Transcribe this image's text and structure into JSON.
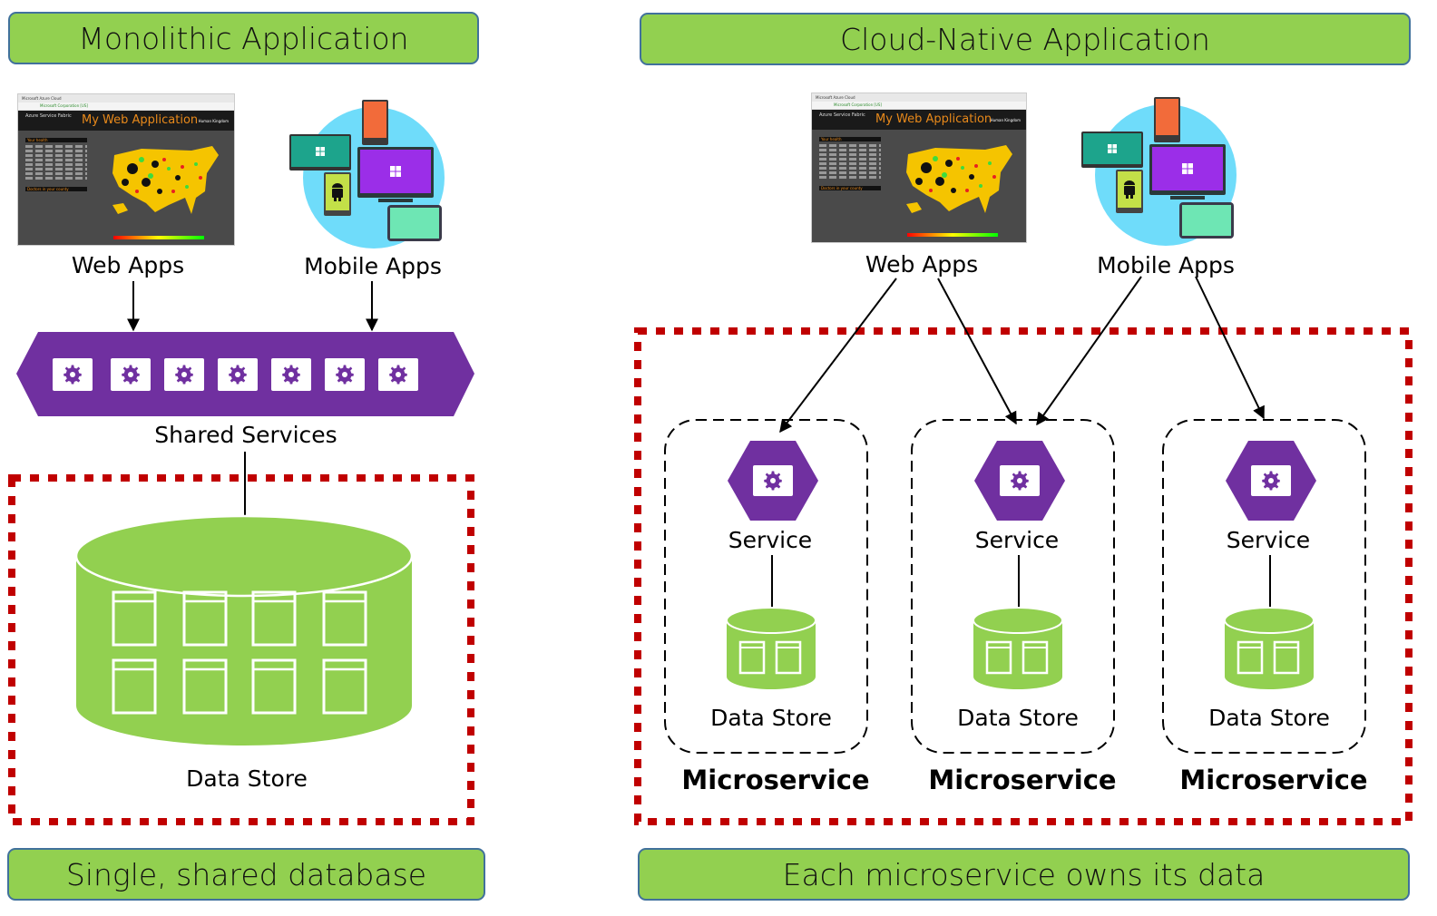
{
  "left": {
    "title": "Monolithic Application",
    "web_apps_label": "Web Apps",
    "mobile_apps_label": "Mobile Apps",
    "shared_services_label": "Shared Services",
    "shared_services_count": 7,
    "data_store_label": "Data Store",
    "data_store_tables": 8,
    "footer": "Single, shared database"
  },
  "right": {
    "title": "Cloud-Native Application",
    "web_apps_label": "Web Apps",
    "mobile_apps_label": "Mobile Apps",
    "microservices": [
      {
        "service_label": "Service",
        "data_store_label": "Data Store",
        "caption": "Microservice"
      },
      {
        "service_label": "Service",
        "data_store_label": "Data Store",
        "caption": "Microservice"
      },
      {
        "service_label": "Service",
        "data_store_label": "Data Store",
        "caption": "Microservice"
      }
    ],
    "footer": "Each microservice owns its data"
  },
  "web_app_screenshot": {
    "tab_title": "Microsoft Azure Cloud",
    "address": "Microsoft Corporation [US]",
    "brand": "Azure Service Fabric",
    "app_title": "My Web Application",
    "user": "Human Kingdom",
    "panel_1": "Your health",
    "panel_2": "Doctors in your county"
  },
  "icons": {
    "gear": "gear-icon",
    "apple": "apple-logo-icon",
    "windows": "windows-logo-icon",
    "android": "android-logo-icon"
  },
  "colors": {
    "banner_green": "#92d050",
    "banner_border": "#41719c",
    "service_purple": "#7030a0",
    "boundary_red": "#c00000",
    "mobile_circle": "#6fdcfa"
  }
}
